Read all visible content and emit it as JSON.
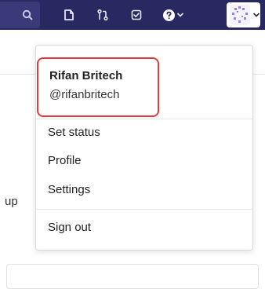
{
  "navbar": {
    "icons": [
      "search-icon",
      "issues-icon",
      "merge-requests-icon",
      "todo-icon",
      "help-icon",
      "chevron-down-icon",
      "avatar",
      "chevron-down-icon"
    ]
  },
  "page": {
    "left_text": "up"
  },
  "user_menu": {
    "name": "Rifan Britech",
    "handle": "@rifanbritech",
    "items": [
      {
        "label": "Set status"
      },
      {
        "label": "Profile"
      },
      {
        "label": "Settings"
      },
      {
        "label": "Sign out"
      }
    ]
  },
  "colors": {
    "navbar": "#292961",
    "highlight": "#e23b3b"
  }
}
